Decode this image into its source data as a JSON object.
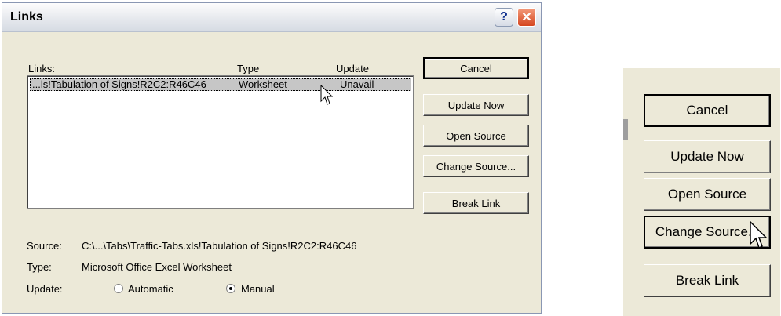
{
  "dialog": {
    "title": "Links",
    "help_icon": "?",
    "close_icon": "✕",
    "list": {
      "headers": {
        "links": "Links:",
        "type": "Type",
        "update": "Update"
      },
      "rows": [
        {
          "link": "...ls!Tabulation of Signs!R2C2:R46C46",
          "type": "Worksheet",
          "update": "Unavail"
        }
      ]
    },
    "buttons": {
      "cancel": "Cancel",
      "update_now": "Update Now",
      "open_source": "Open Source",
      "change_source": "Change Source...",
      "break_link": "Break Link"
    },
    "details": {
      "source_label": "Source:",
      "source_value": "C:\\...\\Tabs\\Traffic-Tabs.xls!Tabulation of Signs!R2C2:R46C46",
      "type_label": "Type:",
      "type_value": "Microsoft Office Excel Worksheet",
      "update_label": "Update:",
      "automatic": "Automatic",
      "manual": "Manual",
      "selected_update": "Manual"
    }
  },
  "zoom_panel": {
    "buttons": {
      "cancel": "Cancel",
      "update_now": "Update Now",
      "open_source": "Open Source",
      "change_source": "Change Source...",
      "break_link": "Break Link"
    }
  }
}
